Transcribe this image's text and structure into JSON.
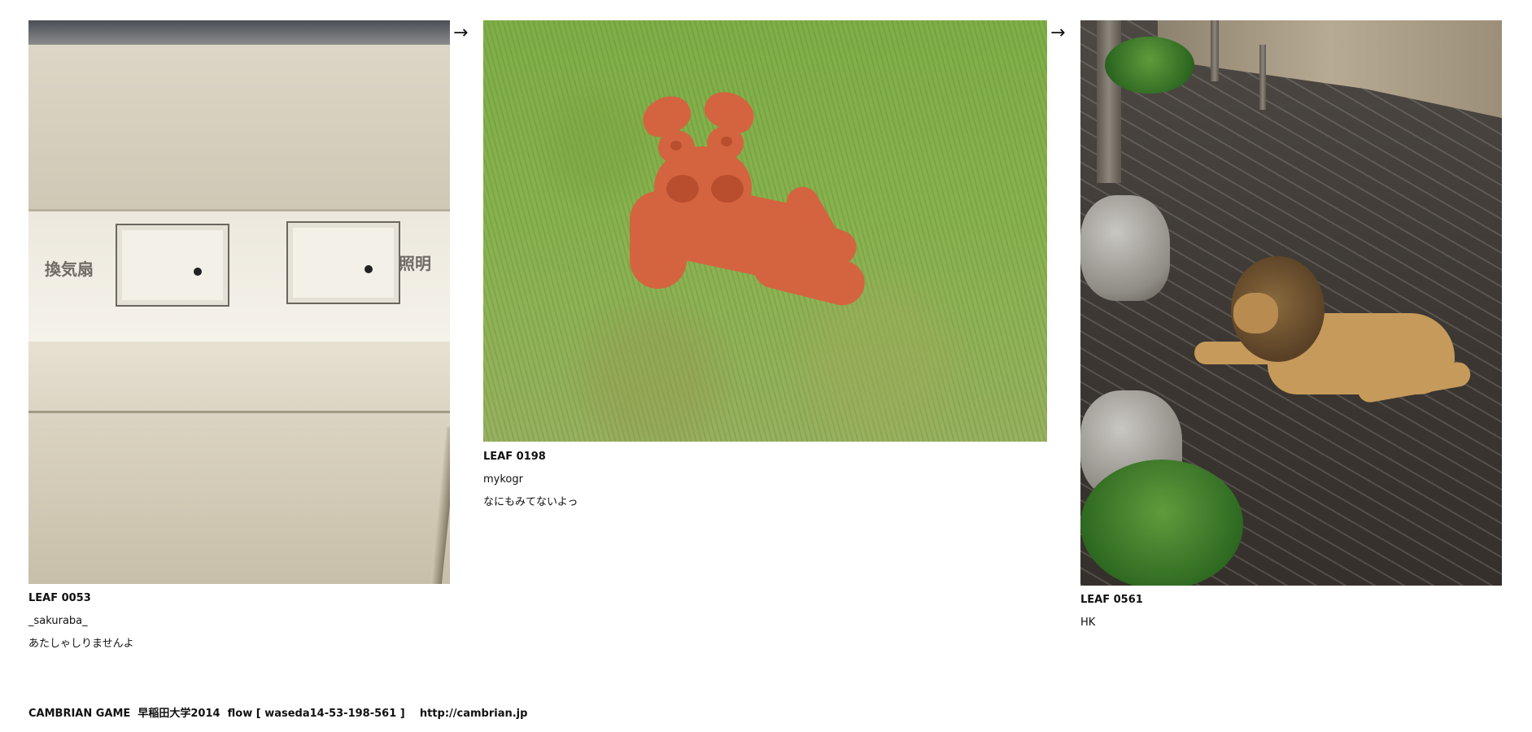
{
  "flow": {
    "arrow_glyph": "→",
    "leaves": [
      {
        "photo_icon": "appliance-switch-panel-photo",
        "photo_text": [
          "換気扇",
          "照明"
        ],
        "id": "LEAF 0053",
        "user": "_sakuraba_",
        "comment": "あたしゃしりませんよ"
      },
      {
        "photo_icon": "clay-figure-on-grass-photo",
        "id": "LEAF 0198",
        "user": "mykogr",
        "comment": "なにもみてないよっ"
      },
      {
        "photo_icon": "lion-in-zoo-enclosure-photo",
        "id": "LEAF 0561",
        "user": "HK",
        "comment": ""
      }
    ]
  },
  "footer": {
    "game": "CAMBRIAN GAME",
    "event": "早稲田大学2014",
    "flow_label": "flow [ waseda14-53-198-561 ]",
    "url": "http://cambrian.jp"
  },
  "colors": {
    "background": "#ffffff",
    "text": "#111111",
    "clay": "#d4643f",
    "grass": "#89b24f"
  }
}
